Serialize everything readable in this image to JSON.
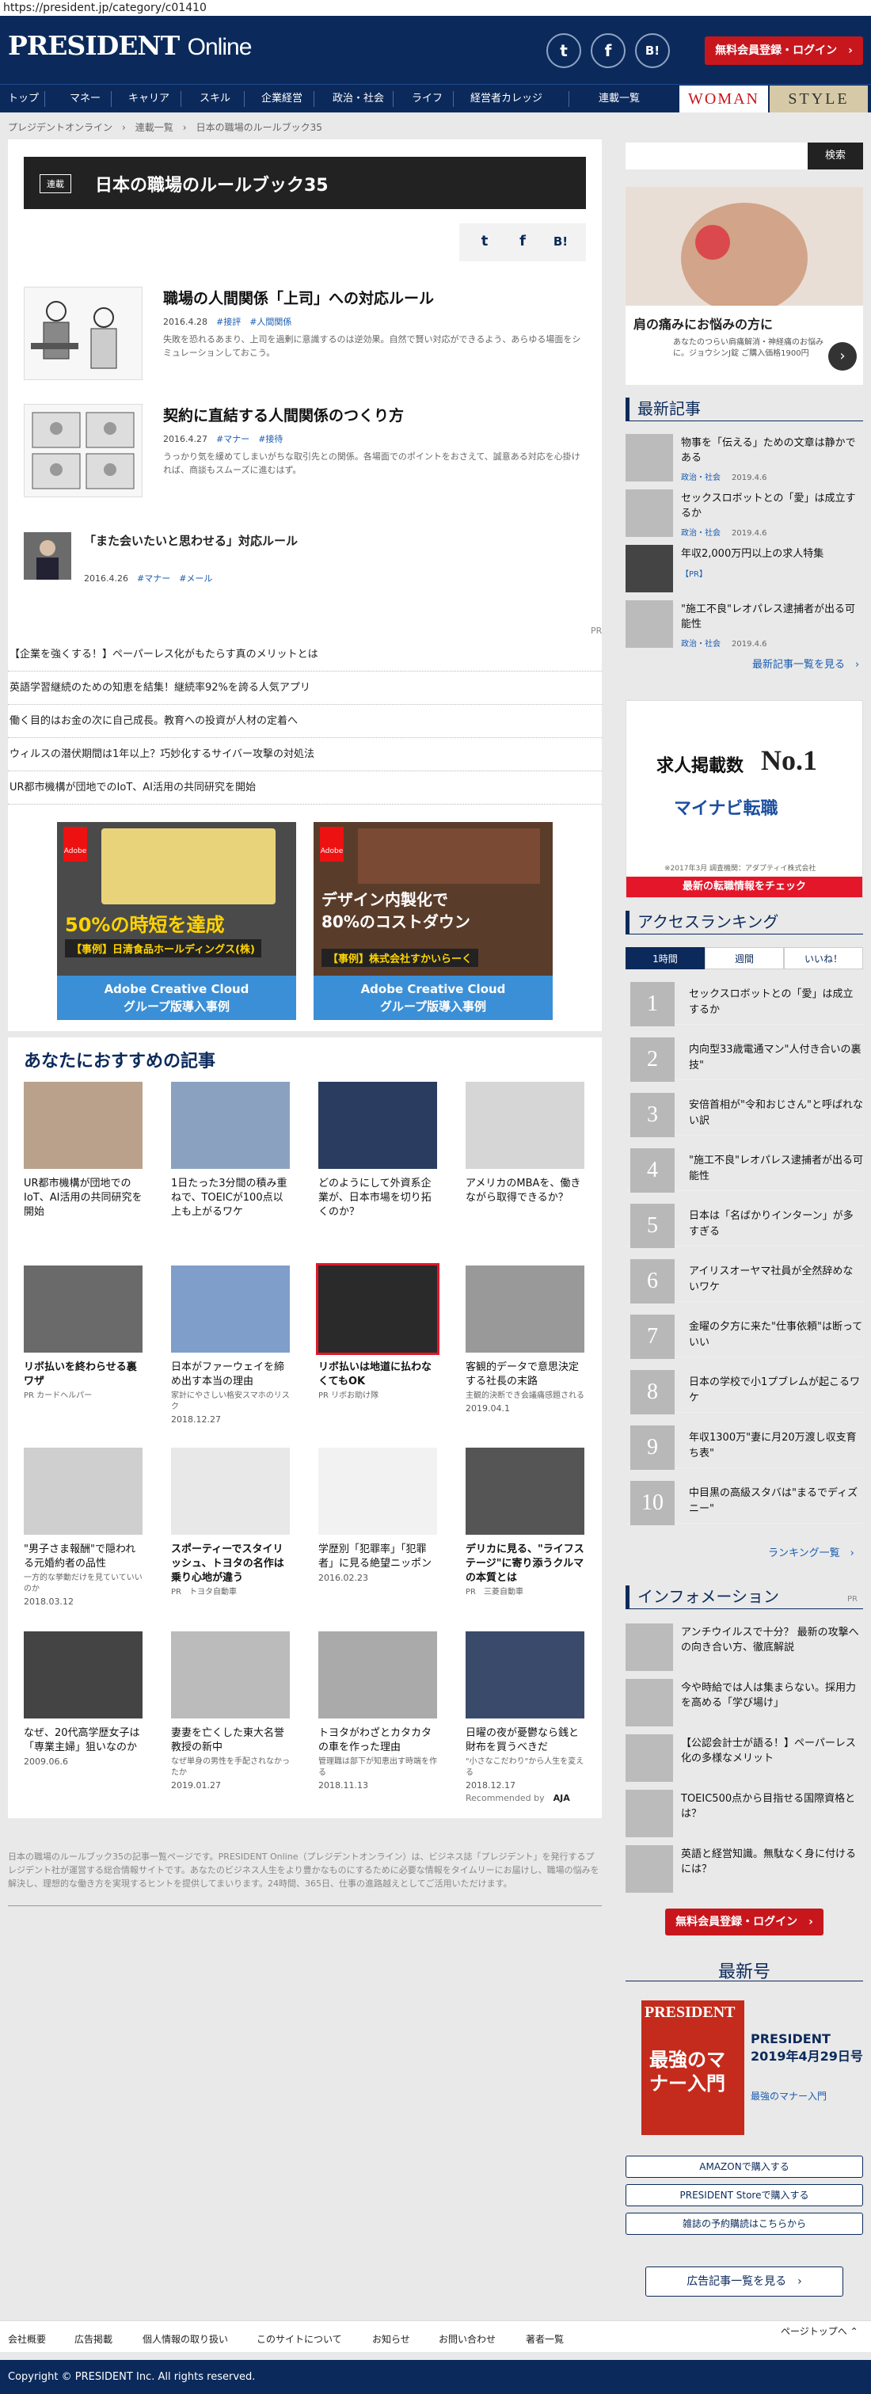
{
  "url": "https://president.jp/category/c01410",
  "header": {
    "logo_main": "PRESIDENT",
    "logo_sub": "Online",
    "social": [
      "twitter-icon",
      "facebook-icon",
      "hatena-icon"
    ],
    "social_glyphs": [
      "t",
      "f",
      "B!"
    ],
    "login_button": "無料会員登録・ログイン　›"
  },
  "nav": {
    "items": [
      "トップ",
      "マネー",
      "キャリア",
      "スキル",
      "企業経営",
      "政治・社会",
      "ライフ",
      "経営者カレッジ",
      "連載一覧"
    ],
    "woman": "WOMAN",
    "style": "STYLE"
  },
  "breadcrumb": "プレジデントオンライン　›　連載一覧　›　日本の職場のルールブック35",
  "title": {
    "badge": "連載",
    "text": "日本の職場のルールブック35"
  },
  "share": [
    "t",
    "f",
    "B!"
  ],
  "articles": [
    {
      "title": "職場の人間関係「上司」への対応ルール",
      "date": "2016.4.28",
      "tags": [
        "#接評",
        "#人間関係"
      ],
      "desc": "失敗を恐れるあまり、上司を過剰に意識するのは逆効果。自然で賢い対応ができるよう、あらゆる場面をシミュレーションしておこう。"
    },
    {
      "title": "契約に直結する人間関係のつくり方",
      "date": "2016.4.27",
      "tags": [
        "#マナー",
        "#接待"
      ],
      "desc": "うっかり気を緩めてしまいがちな取引先との関係。各場面でのポイントをおさえて、誠意ある対応を心掛ければ、商談もスムーズに進むはず。"
    },
    {
      "title": "「また会いたいと思わせる」対応ルール",
      "date": "2016.4.26",
      "tags": [
        "#マナー",
        "#メール"
      ],
      "desc": ""
    }
  ],
  "pr_label": "PR",
  "pr_lines": [
    "【企業を強くする！】ペーパーレス化がもたらす真のメリットとは",
    "英語学習継続のための知恵を結集！継続率92%を誇る人気アプリ",
    "働く目的はお金の次に自己成長。教育への投資が人材の定着へ",
    "ウィルスの潜伏期間は1年以上？巧妙化するサイバー攻撃の対処法",
    "UR都市機構が団地でのIoT、AI活用の共同研究を開始"
  ],
  "ads": [
    {
      "msg": "50%の時短を達成",
      "sub": "【事例】日清食品ホールディングス(株)",
      "foot1": "Adobe Creative Cloud",
      "foot2": "グループ版導入事例",
      "brand": "Adobe"
    },
    {
      "msg": "デザイン内製化で80%のコストダウン",
      "sub": "【事例】株式会社すかいらーく",
      "foot1": "Adobe Creative Cloud",
      "foot2": "グループ版導入事例",
      "brand": "Adobe"
    }
  ],
  "recommend": {
    "title": "あなたにおすすめの記事",
    "cards": [
      {
        "title": "UR都市機構が団地でのIoT、AI活用の共同研究を開始",
        "sub": "",
        "date": ""
      },
      {
        "title": "1日たった3分間の積み重ねで、TOEICが100点以上も上がるワケ",
        "sub": "",
        "date": ""
      },
      {
        "title": "どのようにして外資系企業が、日本市場を切り拓くのか？",
        "sub": "",
        "date": ""
      },
      {
        "title": "アメリカのMBAを、働きながら取得できるか？",
        "sub": "",
        "date": ""
      },
      {
        "title": "リボ払いを終わらせる裏ワザ",
        "sub": "PR カードヘルパー",
        "date": ""
      },
      {
        "title": "日本がファーウェイを締め出す本当の理由",
        "sub": "家計にやさしい格安スマホのリスク",
        "date": "2018.12.27"
      },
      {
        "title": "リボ払いは地道に払わなくてもOK",
        "sub": "PR リボお助け隊",
        "date": ""
      },
      {
        "title": "客観的データで意思決定する社長の末路",
        "sub": "主観的決断でき会議痛感題される",
        "date": "2019.04.1"
      },
      {
        "title": "\"男子さま報酬\"で隠われる元婚約者の品性",
        "sub": "一方的な挙動だけを見ていていいのか",
        "date": "2018.03.12"
      },
      {
        "title": "スポーティーでスタイリッシュ、トヨタの名作は乗り心地が違う",
        "sub": "PR　トヨタ自動車",
        "date": ""
      },
      {
        "title": "学歴別「犯罪率」「犯罪者」に見る絶望ニッポン",
        "sub": "",
        "date": "2016.02.23"
      },
      {
        "title": "デリカに見る、\"ライフステージ\"に寄り添うクルマの本質とは",
        "sub": "PR　三菱自動車",
        "date": ""
      },
      {
        "title": "なぜ、20代高学歴女子は「専業主婦」狙いなのか",
        "sub": "",
        "date": "2009.06.6"
      },
      {
        "title": "妻妻を亡くした東大名誉教授の新中",
        "sub": "なぜ単身の男性を手配されなかったか",
        "date": "2019.01.27"
      },
      {
        "title": "トヨタがわざとカタカタの車を作った理由",
        "sub": "管理職は部下が知恵出す時端を作る",
        "date": "2018.11.13"
      },
      {
        "title": "日曜の夜が憂鬱なら銭と財布を買うべきだ",
        "sub": "\"小さなこだわり\"から人生を変える",
        "date": "2018.12.17"
      }
    ],
    "powered": "Recommended by",
    "powered_brand": "AJA"
  },
  "footer_desc": "日本の職場のルールブック35の記事一覧ページです。PRESIDENT Online（プレジデントオンライン）は、ビジネス誌「プレジデント」を発行するプレジデント社が運営する総合情報サイトです。あなたのビジネス人生をより豊かなものにするために必要な情報をタイムリーにお届けし、職場の悩みを解決し、理想的な働き方を実現するヒントを提供してまいります。24時間、365日、仕事の進路越えとしてご活用いただけます。",
  "sidebar": {
    "search_button": "検索",
    "ad1": {
      "title": "肩の痛みにお悩みの方に",
      "desc": "あなたのつらい肩痛解消・神経痛のお悩みに。ジョウシンJ錠 ご購入価格1900円"
    },
    "latest_title": "最新記事",
    "latest": [
      {
        "title": "物事を「伝える」ための文章は静かである",
        "tag": "政治・社会",
        "date": "2019.4.6"
      },
      {
        "title": "セックスロボットとの「愛」は成立するか",
        "tag": "政治・社会",
        "date": "2019.4.6"
      },
      {
        "title": "年収2,000万円以上の求人特集",
        "tag": "【PR】",
        "date": ""
      },
      {
        "title": "\"施工不良\"レオパレス逮捕者が出る可能性",
        "tag": "政治・社会",
        "date": "2019.4.6"
      }
    ],
    "latest_more": "最新記事一覧を見る　›",
    "job_ad": {
      "title": "求人掲載数",
      "num": "No.1",
      "brand": "マイナビ転職",
      "note": "※2017年3月 調査機関：アダプティイ株式会社",
      "cta": "最新の転職情報をチェック"
    },
    "ranking_title": "アクセスランキング",
    "ranking_tabs": [
      "1時間",
      "週間",
      "いいね！"
    ],
    "ranking": [
      "セックスロボットとの「愛」は成立するか",
      "内向型33歳電通マン\"人付き合いの裏技\"",
      "安倍首相が\"令和おじさん\"と呼ばれない訳",
      "\"施工不良\"レオパレス逮捕者が出る可能性",
      "日本は「名ばかりインターン」が多すぎる",
      "アイリスオーヤマ社員が全然辞めないワケ",
      "金曜の夕方に来た\"仕事依頼\"は断っていい",
      "日本の学校で小1プブレムが起こるワケ",
      "年収1300万\"妻に月20万渡し収支育ち表\"",
      "中目黒の高級スタバは\"まるでディズニー\""
    ],
    "ranking_more": "ランキング一覧　›",
    "info_title": "インフォメーション",
    "info_pr": "PR",
    "info": [
      "アンチウイルスで十分？ 最新の攻撃への向き合い方、徹底解説",
      "今や時給では人は集まらない。採用力を高める「学び場け」",
      "【公認会計士が語る！】ペーパーレス化の多様なメリット",
      "TOEIC500点から目指せる国際資格とは？",
      "英語と経営知識。無駄なく身に付けるには？"
    ],
    "login_button": "無料会員登録・ログイン　›",
    "issue_title": "最新号",
    "issue_name": "PRESIDENT 2019年4月29日号",
    "issue_sub": "最強のマナー入門",
    "cover_brand": "PRESIDENT",
    "cover_title": "最強のマナー入門",
    "buy": [
      "AMAZONで購入する",
      "PRESIDENT Storeで購入する",
      "雑誌の予約購読はこちらから"
    ],
    "ad_list": "広告記事一覧を見る　›"
  },
  "bottom_nav": [
    "会社概要",
    "広告掲載",
    "個人情報の取り扱い",
    "このサイトについて",
    "お知らせ",
    "お問い合わせ",
    "著者一覧"
  ],
  "page_top": "ページトップへ ⌃",
  "copyright": "Copyright © PRESIDENT Inc. All rights reserved.",
  "colors": {
    "navy": "#0b2a5b",
    "red": "#c8161d",
    "link": "#1a5cb0"
  }
}
